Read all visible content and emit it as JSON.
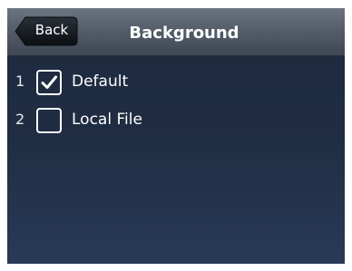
{
  "header": {
    "back_label": "Back",
    "title": "Background"
  },
  "options": [
    {
      "index": "1",
      "label": "Default",
      "checked": true
    },
    {
      "index": "2",
      "label": "Local File",
      "checked": false
    }
  ],
  "colors": {
    "screen_background": "#1f2c42",
    "title_bar": "#555e6a",
    "back_button": "#14181e",
    "text": "#ffffff"
  },
  "icons": {
    "checked": "checkmark-icon",
    "unchecked": "empty-checkbox-icon"
  }
}
